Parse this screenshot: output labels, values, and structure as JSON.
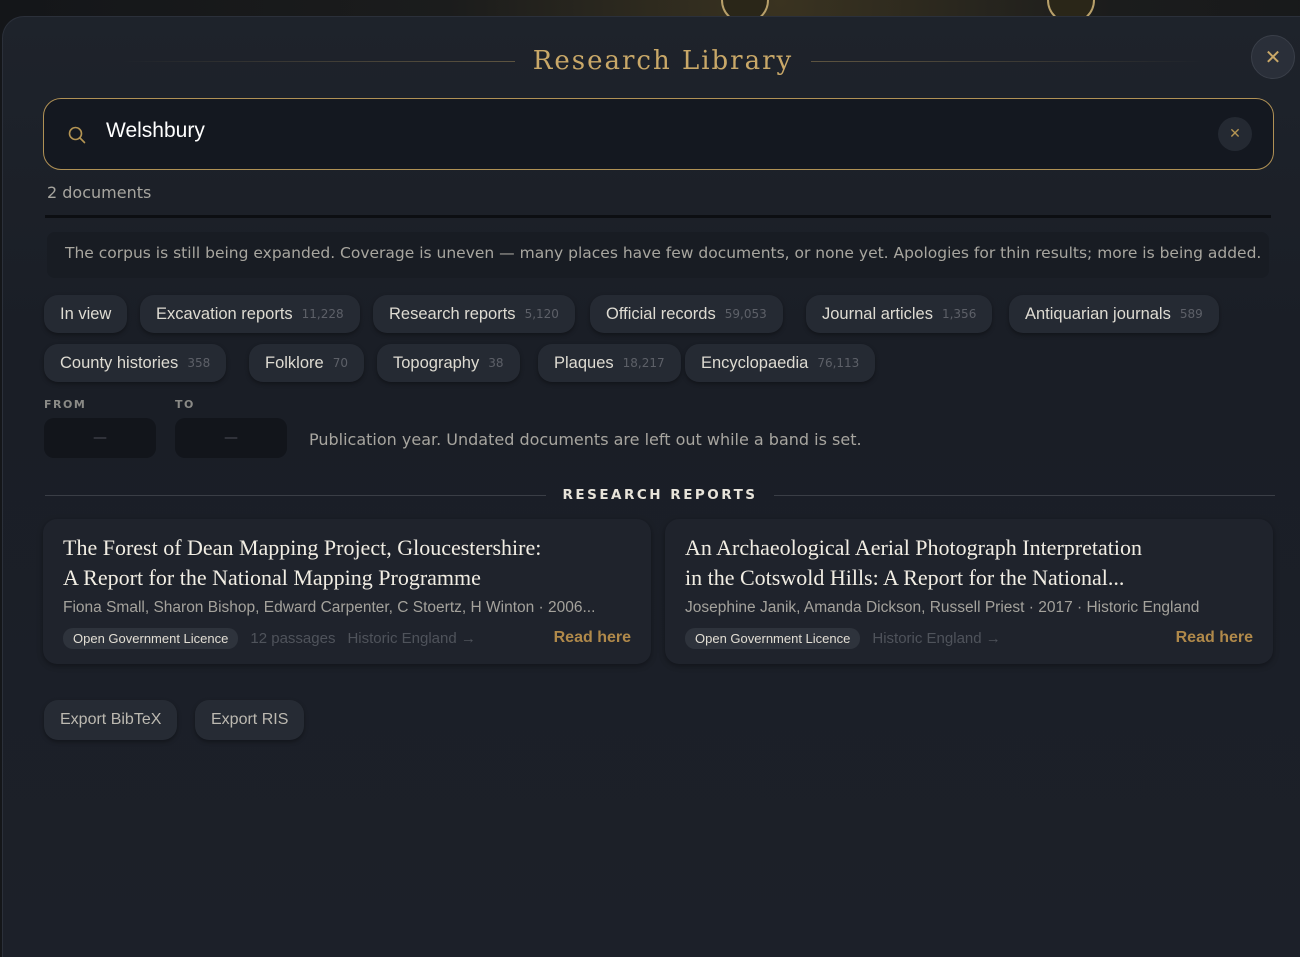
{
  "header": {
    "title": "Research Library",
    "close_icon": "close-icon"
  },
  "search": {
    "value": "Welshbury",
    "clear_icon": "close-icon"
  },
  "results": {
    "count_text": "2 documents"
  },
  "notice": "The corpus is still being expanded. Coverage is uneven — many places have few documents, or none yet. Apologies for thin results; more is being added.",
  "filters": {
    "chips": [
      {
        "label": "In view",
        "count": ""
      },
      {
        "label": "Excavation reports",
        "count": "11,228"
      },
      {
        "label": "Research reports",
        "count": "5,120"
      },
      {
        "label": "Official records",
        "count": "59,053"
      },
      {
        "label": "Journal articles",
        "count": "1,356"
      },
      {
        "label": "Antiquarian journals",
        "count": "589"
      },
      {
        "label": "County histories",
        "count": "358"
      },
      {
        "label": "Folklore",
        "count": "70"
      },
      {
        "label": "Topography",
        "count": "38"
      },
      {
        "label": "Plaques",
        "count": "18,217"
      },
      {
        "label": "Encyclopaedia",
        "count": "76,113"
      }
    ]
  },
  "years": {
    "from_label": "FROM",
    "to_label": "TO",
    "from_value": "—",
    "to_value": "—",
    "note": "Publication year. Undated documents are left out while a band is set."
  },
  "section": {
    "title": "RESEARCH REPORTS"
  },
  "cards": [
    {
      "title_line1": "The Forest of Dean Mapping Project, Gloucestershire:",
      "title_line2": "A Report for the National Mapping Programme",
      "meta": "Fiona Small, Sharon Bishop, Edward Carpenter, C Stoertz, H Winton · 2006...",
      "licence": "Open Government Licence",
      "passages": "12 passages",
      "source": "Historic England →",
      "read": "Read here"
    },
    {
      "title_line1": "An Archaeological Aerial Photograph Interpretation",
      "title_line2": "in the Cotswold Hills: A Report for the National...",
      "meta": "Josephine Janik, Amanda Dickson, Russell Priest · 2017 · Historic England",
      "licence": "Open Government Licence",
      "passages": "",
      "source": "Historic England →",
      "read": "Read here"
    }
  ],
  "export": {
    "bibtex": "Export BibTeX",
    "ris": "Export RIS"
  },
  "colors": {
    "accent": "#c9a868",
    "link": "#b0894a",
    "panel": "#1e232b"
  }
}
